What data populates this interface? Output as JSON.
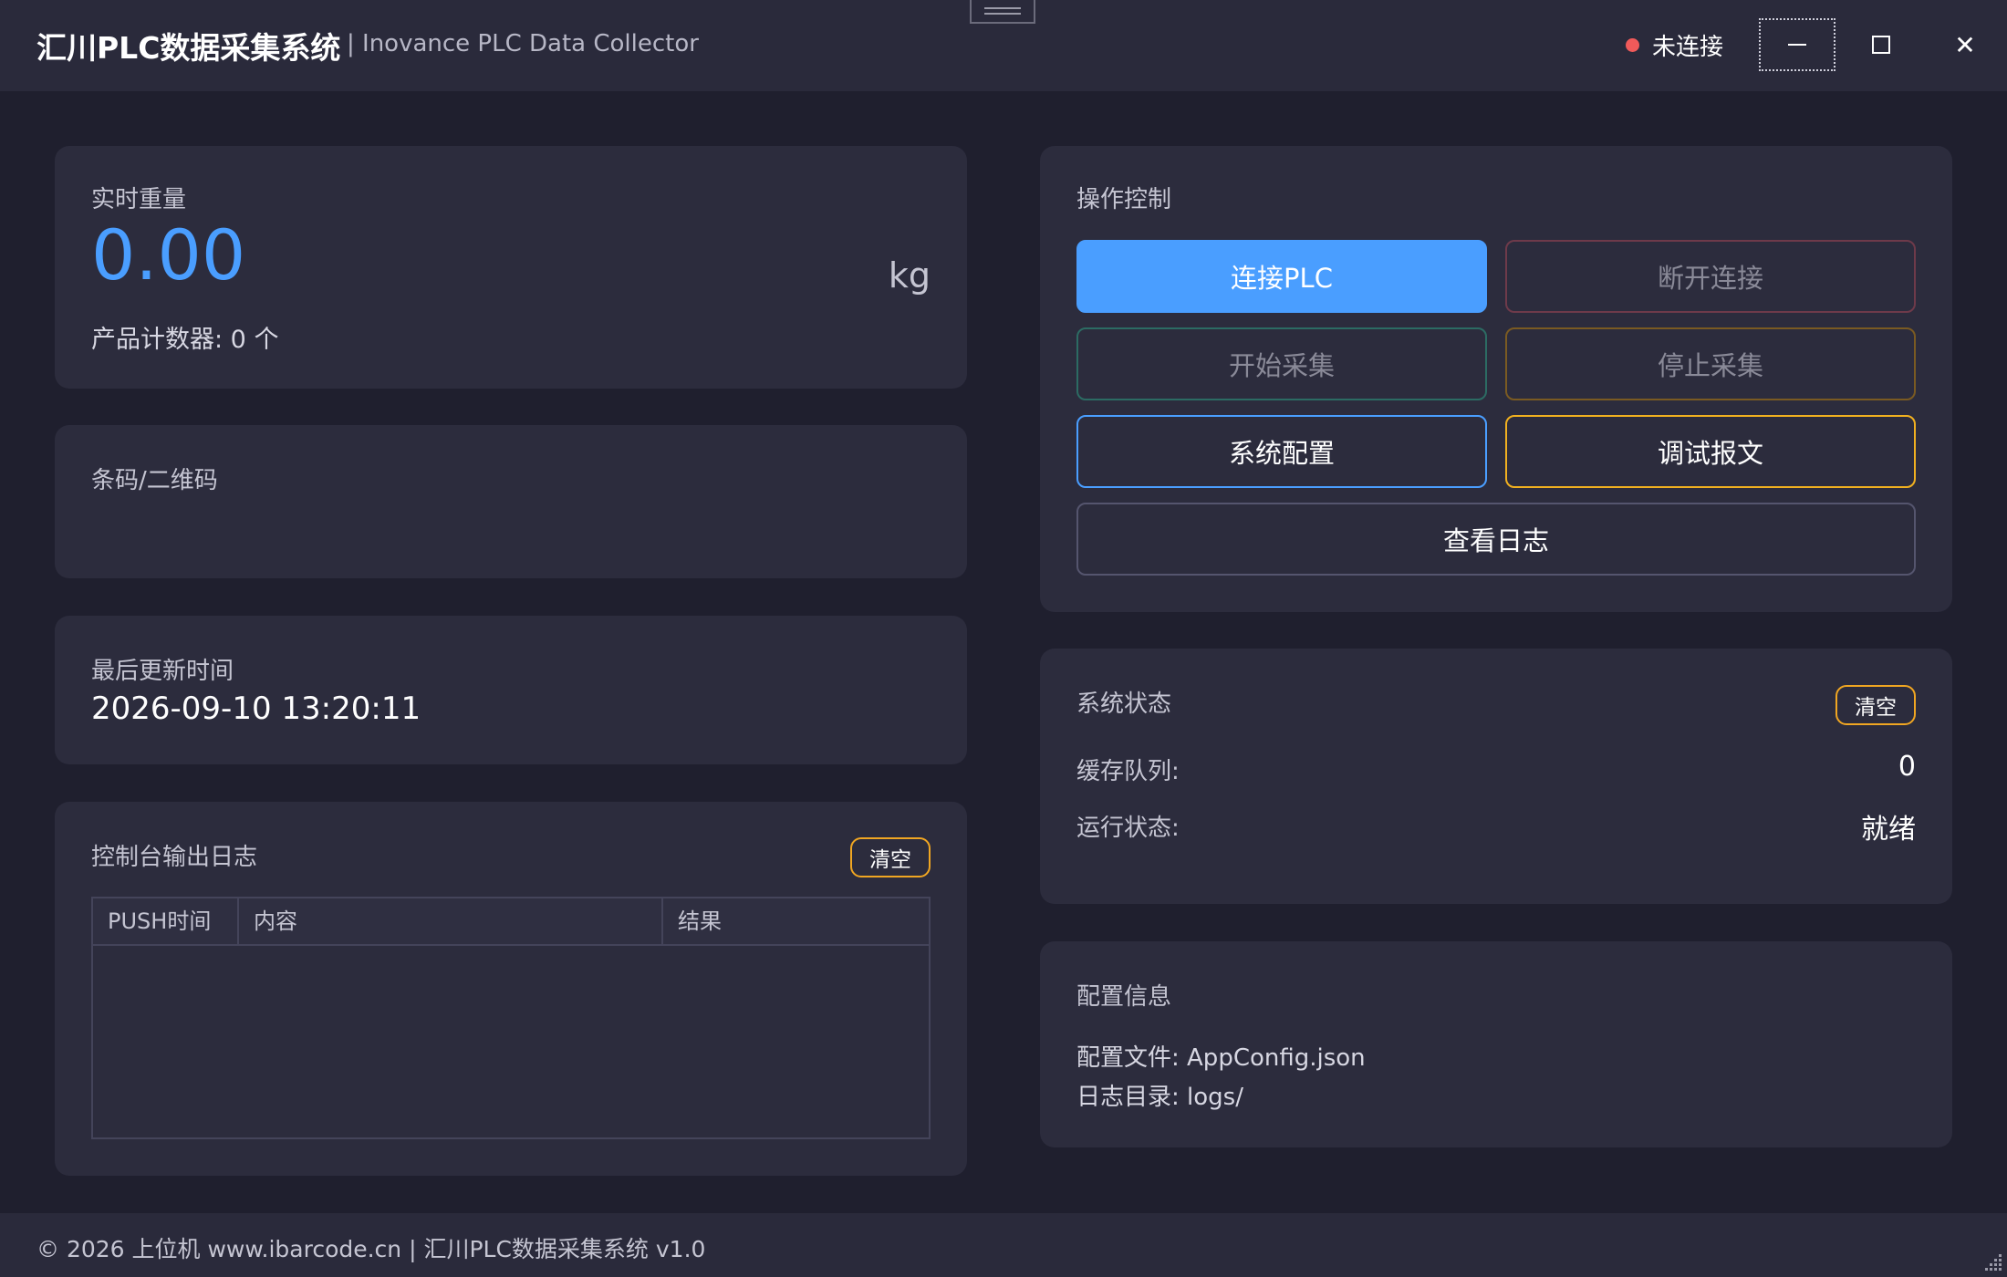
{
  "titlebar": {
    "title": "汇川PLC数据采集系统",
    "subtitle": "| Inovance PLC Data Collector",
    "status_text": "未连接",
    "status_color": "#f05a5a",
    "close_glyph": "✕"
  },
  "weight": {
    "label": "实时重量",
    "value": "0.00",
    "unit": "kg",
    "counter": "产品计数器: 0 个"
  },
  "barcode": {
    "label": "条码/二维码"
  },
  "last_update": {
    "label": "最后更新时间",
    "value": "2026-09-10 13:20:11"
  },
  "console_log": {
    "label": "控制台输出日志",
    "clear_label": "清空",
    "columns": [
      "PUSH时间",
      "内容",
      "结果"
    ]
  },
  "operations": {
    "label": "操作控制",
    "connect": "连接PLC",
    "disconnect": "断开连接",
    "start": "开始采集",
    "stop": "停止采集",
    "config": "系统配置",
    "debug": "调试报文",
    "logs": "查看日志"
  },
  "system_status": {
    "label": "系统状态",
    "clear_label": "清空",
    "queue_label": "缓存队列:",
    "queue_value": "0",
    "run_label": "运行状态:",
    "run_value": "就绪"
  },
  "config_info": {
    "label": "配置信息",
    "config_file": "配置文件: AppConfig.json",
    "log_dir": "日志目录: logs/"
  },
  "footer": {
    "text": "© 2026 上位机 www.ibarcode.cn | 汇川PLC数据采集系统 v1.0"
  },
  "colors": {
    "accent": "#4a9eff",
    "warning": "#f0a622",
    "background": "#1f1f2e",
    "panel": "#2c2c3d"
  }
}
